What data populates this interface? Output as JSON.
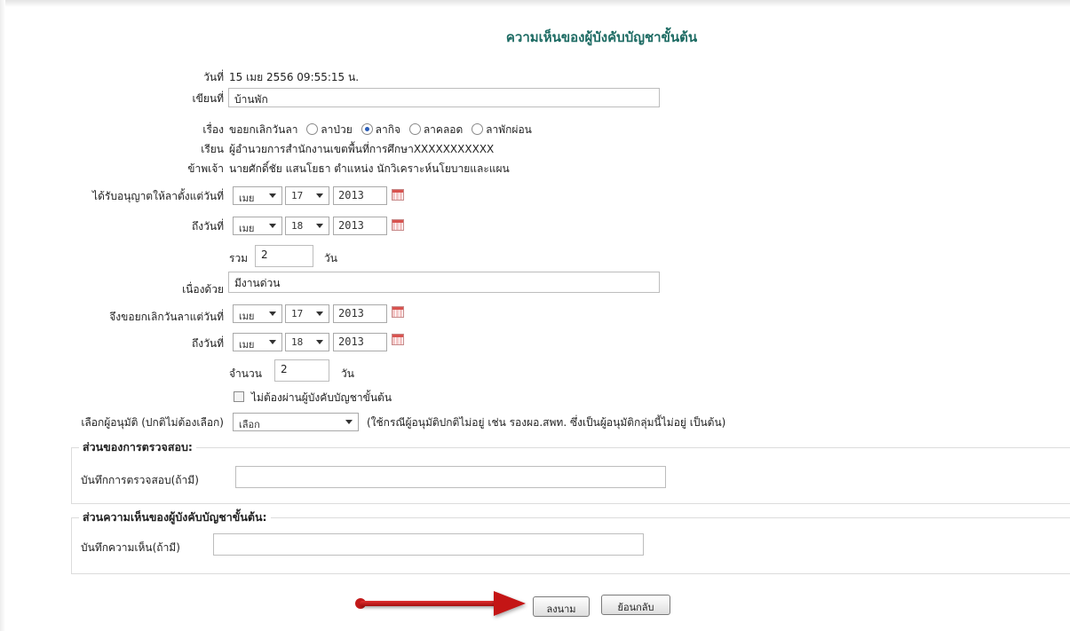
{
  "page_title": "ความเห็นของผู้บังคับบัญชาขั้นต้น",
  "date": {
    "label": "วันที่",
    "value": "15 เมย 2556 09:55:15 น."
  },
  "written_at": {
    "label": "เขียนที่",
    "value": "บ้านพัก"
  },
  "subject": {
    "label": "เรื่อง",
    "prefix": "ขอยกเลิกวันลา",
    "options": [
      {
        "label": "ลาป่วย",
        "selected": false
      },
      {
        "label": "ลากิจ",
        "selected": true
      },
      {
        "label": "ลาคลอด",
        "selected": false
      },
      {
        "label": "ลาพักผ่อน",
        "selected": false
      }
    ]
  },
  "to": {
    "label": "เรียน",
    "value": "ผู้อำนวยการสำนักงานเขตพื้นที่การศึกษาXXXXXXXXXXX"
  },
  "me": {
    "label": "ข้าพเจ้า",
    "value": "นายศักดิ์ชัย  แสนโยธา  ตำแหน่ง  นักวิเคราะห์นโยบายและแผน"
  },
  "granted_from": {
    "label": "ได้รับอนุญาตให้ลาตั้งแต่วันที่",
    "month": "เมย",
    "day": "17",
    "year": "2013"
  },
  "granted_to": {
    "label": "ถึงวันที่",
    "month": "เมย",
    "day": "18",
    "year": "2013"
  },
  "total": {
    "label": "รวม",
    "value": "2",
    "unit": "วัน"
  },
  "reason": {
    "label": "เนื่องด้วย",
    "value": "มีงานด่วน"
  },
  "cancel_from": {
    "label": "จึงขอยกเลิกวันลาแต่วันที่",
    "month": "เมย",
    "day": "17",
    "year": "2013"
  },
  "cancel_to": {
    "label": "ถึงวันที่",
    "month": "เมย",
    "day": "18",
    "year": "2013"
  },
  "count": {
    "label": "จำนวน",
    "value": "2",
    "unit": "วัน"
  },
  "skip_supervisor": {
    "label": "ไม่ต้องผ่านผู้บังคับบัญชาขั้นต้น",
    "checked": false
  },
  "approver": {
    "label": "เลือกผู้อนุมัติ (ปกติไม่ต้องเลือก)",
    "selected": "เลือก",
    "note": "(ใช้กรณีผู้อนุมัติปกติไม่อยู่ เช่น รองผอ.สพท. ซึ่งเป็นผู้อนุมัติกลุ่มนี้ไม่อยู่ เป็นต้น)"
  },
  "inspection": {
    "legend": "ส่วนของการตรวจสอบ:",
    "field_label": "บันทึกการตรวจสอบ(ถ้ามี)",
    "value": ""
  },
  "opinion": {
    "legend": "ส่วนความเห็นของผู้บังคับบัญชาขั้นต้น:",
    "field_label": "บันทึกความเห็น(ถ้ามี)",
    "value": ""
  },
  "buttons": {
    "sign": "ลงนาม",
    "back": "ย้อนกลับ"
  },
  "icons": {
    "calendar": "calendar-icon",
    "dropdown": "chevron-down-icon",
    "annotation": "red-arrow-annotation"
  },
  "colors": {
    "title": "#1d6b63",
    "annotation": "#c41515"
  }
}
